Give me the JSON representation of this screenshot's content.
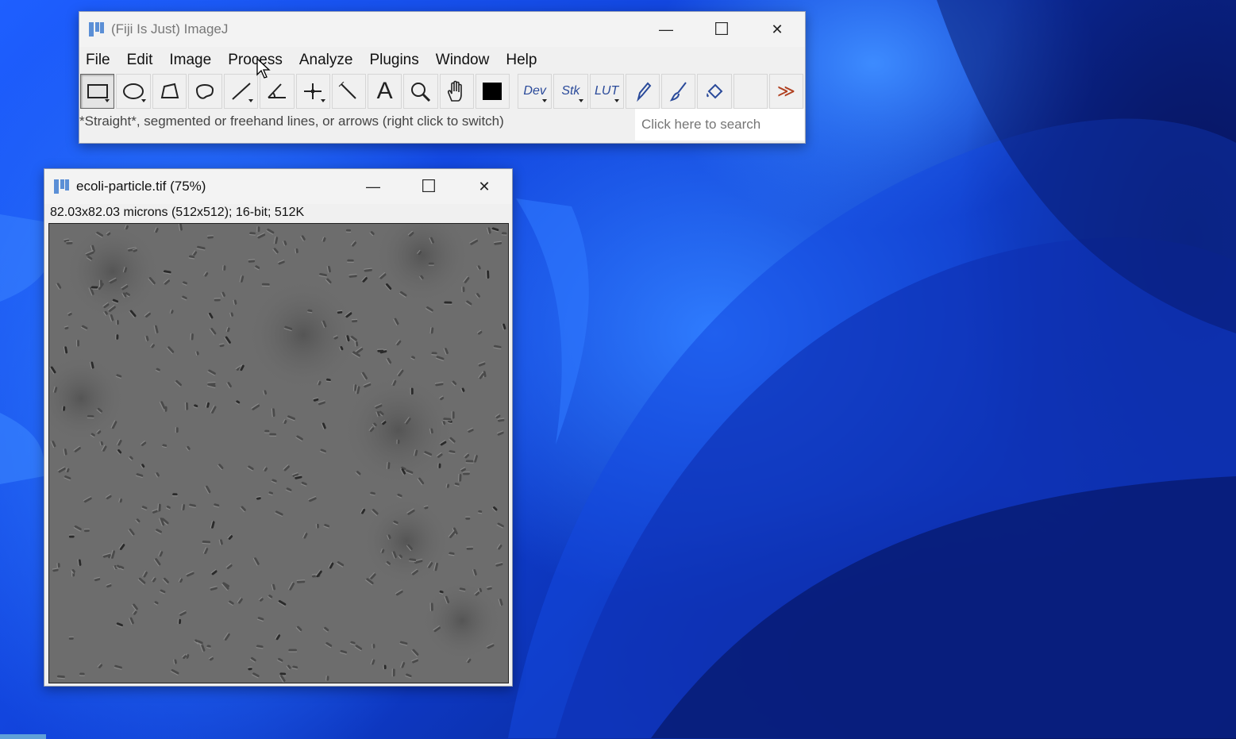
{
  "main_window": {
    "title": "(Fiji Is Just) ImageJ",
    "controls": {
      "minimize": "—",
      "maximize": "☐",
      "close": "✕"
    },
    "menu": [
      "File",
      "Edit",
      "Image",
      "Process",
      "Analyze",
      "Plugins",
      "Window",
      "Help"
    ],
    "tools": [
      {
        "name": "rectangle-tool",
        "icon": "rectangle-icon"
      },
      {
        "name": "oval-tool",
        "icon": "oval-icon"
      },
      {
        "name": "polygon-tool",
        "icon": "polygon-icon"
      },
      {
        "name": "freehand-tool",
        "icon": "freehand-icon"
      },
      {
        "name": "straight-line-tool",
        "icon": "line-icon"
      },
      {
        "name": "angle-tool",
        "icon": "angle-icon"
      },
      {
        "name": "point-tool",
        "icon": "crosshair-icon"
      },
      {
        "name": "wand-tool",
        "icon": "wand-icon"
      },
      {
        "name": "text-tool",
        "icon": "text-icon",
        "label": "A"
      },
      {
        "name": "magnifier-tool",
        "icon": "magnifier-icon"
      },
      {
        "name": "scroll-tool",
        "icon": "hand-icon"
      },
      {
        "name": "color-picker-tool",
        "icon": "color-swatch-icon"
      }
    ],
    "extra_tools": [
      {
        "name": "dev-menu",
        "label": "Dev"
      },
      {
        "name": "stk-menu",
        "label": "Stk"
      },
      {
        "name": "lut-menu",
        "label": "LUT"
      }
    ],
    "more_label": "≫",
    "status": "*Straight*, segmented or freehand lines, or arrows (right click to switch)",
    "search_placeholder": "Click here to search"
  },
  "image_window": {
    "title": "ecoli-particle.tif (75%)",
    "info": "82.03x82.03 microns (512x512); 16-bit; 512K",
    "controls": {
      "minimize": "—",
      "maximize": "☐",
      "close": "✕"
    }
  },
  "colors": {
    "desktop_accent": "#1e5fff",
    "window_bg": "#f0f0f0",
    "icon_blue": "#5b8fd6"
  }
}
